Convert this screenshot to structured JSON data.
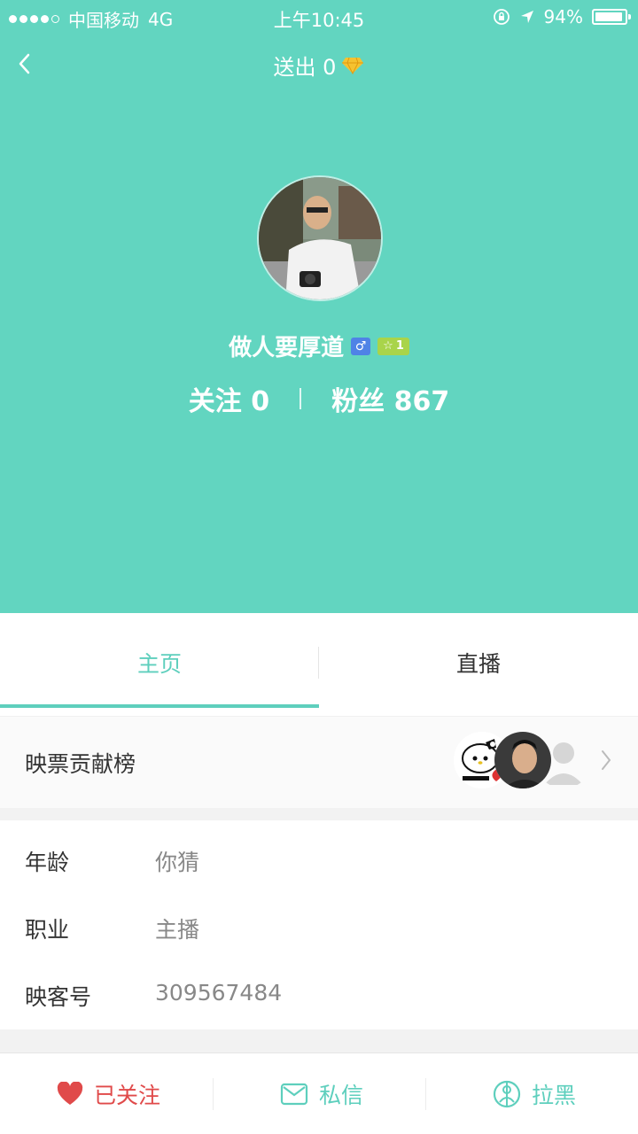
{
  "status_bar": {
    "carrier": "中国移动",
    "network": "4G",
    "time": "上午10:45",
    "battery": "94%",
    "battery_level": 0.94
  },
  "nav": {
    "sent_label": "送出 0"
  },
  "profile": {
    "name": "做人要厚道",
    "gender_symbol": "♂",
    "level": "1",
    "following_label": "关注 0",
    "fans_label": "粉丝 867"
  },
  "tabs": [
    {
      "label": "主页",
      "active": true
    },
    {
      "label": "直播",
      "active": false
    }
  ],
  "contribution": {
    "label": "映票贡献榜",
    "avatars": [
      "hello-kitty-avatar",
      "man-avatar",
      "placeholder-avatar"
    ]
  },
  "info": [
    {
      "label": "年龄",
      "value": "你猜"
    },
    {
      "label": "职业",
      "value": "主播"
    },
    {
      "label": "映客号",
      "value": "309567484"
    }
  ],
  "bottom_bar": {
    "follow": "已关注",
    "message": "私信",
    "block": "拉黑"
  },
  "colors": {
    "header_bg": "#62d5c0",
    "accent": "#5ecfbd",
    "followed_red": "#e04a4a",
    "gender_blue": "#4f83e6",
    "level_green": "#a9d44a"
  }
}
